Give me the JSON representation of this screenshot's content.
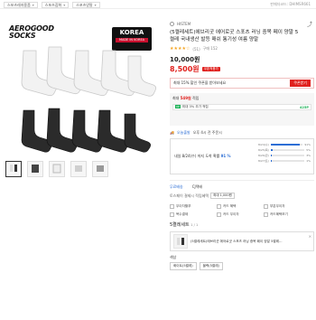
{
  "breadcrumbs": [
    {
      "label": "스포츠레저용품"
    },
    {
      "label": "스포츠잡화"
    },
    {
      "label": "스포츠양말"
    }
  ],
  "seller_code": "판매자코드: DHIMSR661",
  "image": {
    "logo_line1": "AEROGOOD",
    "logo_line2": "SOCKS",
    "badge_main": "KOREA",
    "badge_sub": "MADE IN KOREA"
  },
  "brand": "HISTEM",
  "title": "(5켤레세트)에브리굿 에어로굿 스포츠 러닝 중목 페이 양말 5켤레 국내생산 발등 매쉬 통기성 여름 양말",
  "rating": {
    "stars": "★★★★☆",
    "count": "(51)",
    "reviews": "구매 152"
  },
  "price": {
    "original": "10,000원",
    "sale": "8,500원",
    "tag": "쿠폰적용가"
  },
  "coupon": {
    "text": "최대 15% 할인 쿠폰을 받아보세요",
    "button": "쿠폰받기"
  },
  "points": {
    "title_prefix": "최대 ",
    "title_value": "549원",
    "title_suffix": " 적립",
    "badge": "0P",
    "row_text": "최대 3% 추가 적립",
    "row_value": "425P"
  },
  "delivery": {
    "label": "오늘출발",
    "cutoff": "오후 4시 전 주문시",
    "summary_prefix": "내일 8/24(수) 까지 도착 확률 ",
    "summary_value": "91 %",
    "dist": [
      {
        "day": "8/24(수)",
        "pct": 91,
        "label": "91%"
      },
      {
        "day": "8/25(목)",
        "pct": 5,
        "label": "5%"
      },
      {
        "day": "8/26(금)",
        "pct": 3,
        "label": "3%"
      },
      {
        "day": "8/27(토)",
        "pct": 1,
        "label": "1%"
      }
    ]
  },
  "info_rows": [
    {
      "key": "무료배송",
      "value": "CJ택배"
    }
  ],
  "cards": {
    "text": "토스페이 결제시 적립혜택",
    "chip": "최대 1,000원"
  },
  "grid_buttons": [
    {
      "label": "무이자할부"
    },
    {
      "label": "카드 혜택"
    },
    {
      "label": "부분무이자"
    },
    {
      "label": "복수결제"
    },
    {
      "label": "카드 무이자"
    },
    {
      "label": "카드혜택보기"
    }
  ],
  "set": {
    "title": "5켤레세트",
    "sub": "1 / 1"
  },
  "product_card": {
    "title": "(5켤레세트)에브리굿 에어로굿 스포츠 러닝 중목 페이 양말 5켤레...",
    "close": "✕"
  },
  "options": {
    "label": "색상",
    "buttons": [
      "화이트(5켤레)",
      "블랙(5켤레)"
    ]
  }
}
